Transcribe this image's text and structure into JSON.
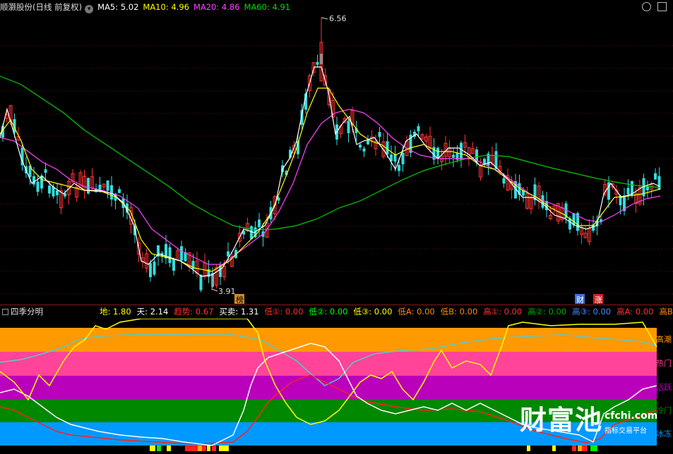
{
  "header": {
    "stock_title": "顺灏股份(日线 前复权)",
    "ma5_label": "MA5: 5.02",
    "ma10_label": "MA10: 4.96",
    "ma20_label": "MA20: 4.86",
    "ma60_label": "MA60: 4.91",
    "dropdown_icon": "chevron-down-icon",
    "colors": {
      "ma5": "#ffffff",
      "ma10": "#ffff00",
      "ma20": "#ff44ff",
      "ma60": "#00cc00"
    }
  },
  "main_chart": {
    "high_annotation": "6.56",
    "low_annotation": "3.91",
    "badges": [
      {
        "text": "榜",
        "color": "#d48a2a"
      },
      {
        "text": "财",
        "color": "#3a6fd8"
      },
      {
        "text": "涨",
        "color": "#cc2222"
      }
    ]
  },
  "indicator": {
    "name": "四季分明",
    "values": [
      {
        "label": "地:",
        "value": "1.80",
        "color": "#ffff00"
      },
      {
        "label": "天:",
        "value": "2.14",
        "color": "#ffffff"
      },
      {
        "label": "趋势:",
        "value": "0.67",
        "color": "#ff3030"
      },
      {
        "label": "买卖:",
        "value": "1.31",
        "color": "#ffffff"
      },
      {
        "label": "低①:",
        "value": "0.00",
        "color": "#ff3030"
      },
      {
        "label": "低②:",
        "value": "0.00",
        "color": "#00ff00"
      },
      {
        "label": "低③:",
        "value": "0.00",
        "color": "#ffff00"
      },
      {
        "label": "低A:",
        "value": "0.00",
        "color": "#ff8800"
      },
      {
        "label": "低B:",
        "value": "0.00",
        "color": "#ff8800"
      },
      {
        "label": "高①:",
        "value": "0.00",
        "color": "#ff3030"
      },
      {
        "label": "高②:",
        "value": "0.00",
        "color": "#00aa00"
      },
      {
        "label": "高③:",
        "value": "0.00",
        "color": "#4488ff"
      },
      {
        "label": "高A:",
        "value": "0.00",
        "color": "#ff3030"
      },
      {
        "label": "高B:",
        "value": "0.00",
        "color": "#ff8800"
      }
    ],
    "zones": [
      {
        "text": "高潮",
        "color": "#ff9900"
      },
      {
        "text": "热门",
        "color": "#ff4499"
      },
      {
        "text": "活跃",
        "color": "#bb00bb"
      },
      {
        "text": "冷门",
        "color": "#008800"
      },
      {
        "text": "冰冻",
        "color": "#0099ff"
      }
    ]
  },
  "watermark": {
    "big": "财富池",
    "url": "cfchi.com",
    "sub": "指标交易平台"
  }
}
